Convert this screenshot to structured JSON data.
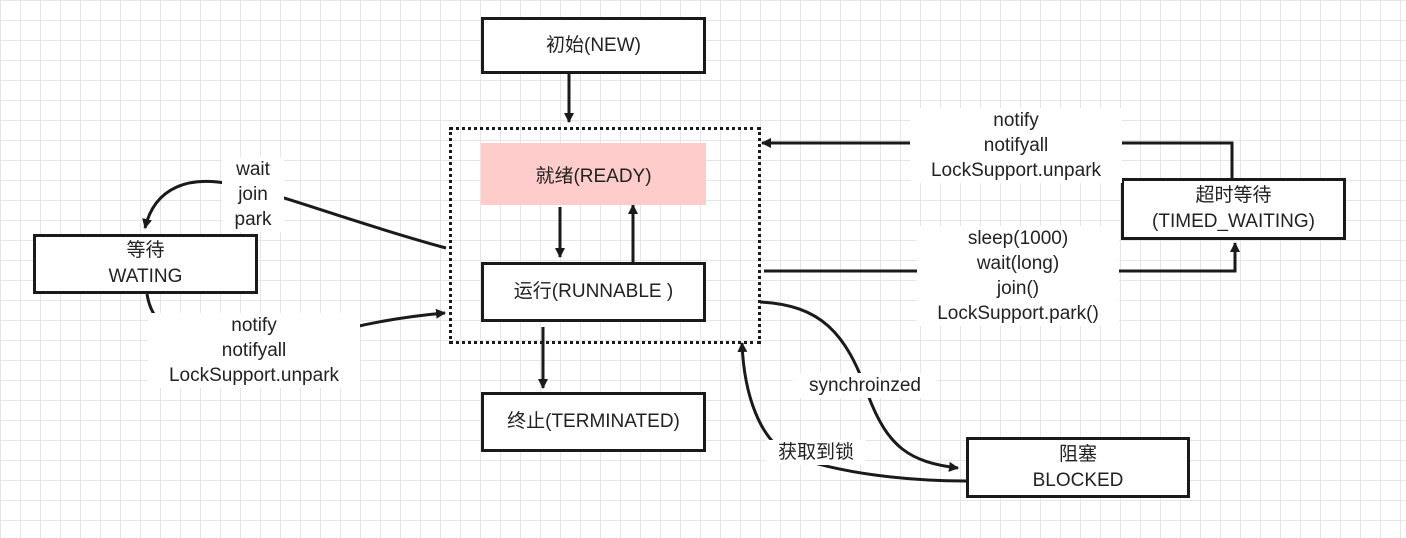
{
  "colors": {
    "stroke": "#1a1a1a",
    "ready_fill": "#ffcccc",
    "grid": "#e6e6e6"
  },
  "states": {
    "new": "初始(NEW)",
    "ready": "就绪(READY)",
    "runnable": "运行(RUNNABLE )",
    "terminated": "终止(TERMINATED)",
    "waiting": [
      "等待",
      "WATING"
    ],
    "timed_waiting": [
      "超时等待",
      "(TIMED_WAITING)"
    ],
    "blocked": [
      "阻塞",
      "BLOCKED"
    ]
  },
  "transitions": {
    "to_waiting": [
      "wait",
      "join",
      "park"
    ],
    "from_waiting": [
      "notify",
      "notifyall",
      "LockSupport.unpark"
    ],
    "from_timed_waiting": [
      "notify",
      "notifyall",
      "LockSupport.unpark"
    ],
    "to_timed_waiting": [
      "sleep(1000)",
      "wait(long)",
      "join()",
      "LockSupport.park()"
    ],
    "to_blocked": "synchroinzed",
    "from_blocked": "获取到锁"
  }
}
